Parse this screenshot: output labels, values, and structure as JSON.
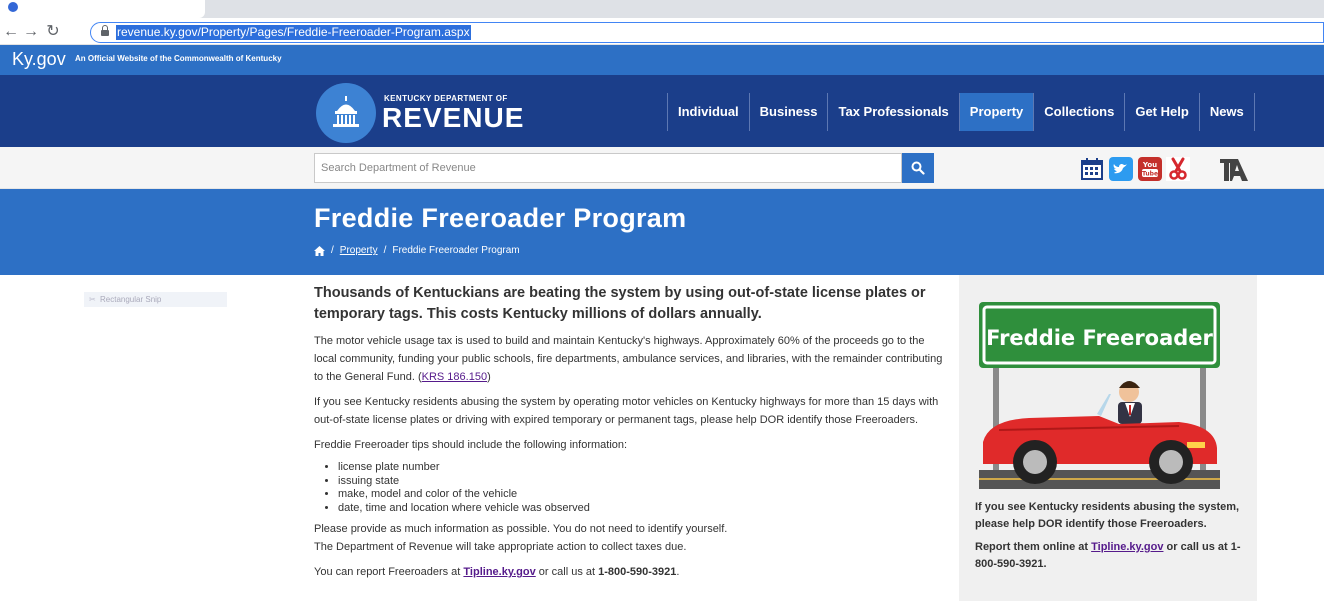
{
  "browser": {
    "url": "revenue.ky.gov/Property/Pages/Freddie-Freeroader-Program.aspx"
  },
  "kygov": {
    "logo_ky": "Ky",
    "logo_gov": ".gov",
    "tagline": "An Official Website of the Commonwealth of Kentucky"
  },
  "header": {
    "dept_small": "KENTUCKY DEPARTMENT OF",
    "dept_big": "REVENUE",
    "nav": [
      {
        "label": "Individual"
      },
      {
        "label": "Business"
      },
      {
        "label": "Tax Professionals"
      },
      {
        "label": "Property"
      },
      {
        "label": "Collections"
      },
      {
        "label": "Get Help"
      },
      {
        "label": "News"
      }
    ],
    "active_nav": "Property"
  },
  "search": {
    "placeholder": "Search Department of Revenue"
  },
  "social_icons": [
    "calendar-icon",
    "twitter-icon",
    "youtube-icon",
    "scissors-icon",
    "ta-icon"
  ],
  "banner": {
    "title": "Freddie Freeroader Program",
    "breadcrumb": [
      "Property",
      "Freddie Freeroader Program"
    ]
  },
  "snip": {
    "label": "Rectangular Snip"
  },
  "main": {
    "lead": "Thousands of Kentuckians are beating the system by using out-of-state license plates or temporary tags.  This costs Kentucky millions of dollars annually.",
    "p1_text": "The motor vehicle usage tax is used to build and maintain Kentucky's highways. Approximately 60% of the proceeds go to the local community, funding your public schools, fire departments, ambulance services, and libraries, with the remainder contributing to the General Fund.  (",
    "p1_link": "KRS 186.150",
    "p1_end": ")",
    "p2": "If you see Kentucky residents abusing the system by operating motor vehicles on Kentucky highways for more than 15 days with out-of-state license plates or driving with expired temporary or permanent tags, please help DOR identify those Freeroaders.",
    "p3": "Freddie Freeroader tips should include the following information:",
    "tips": [
      "license plate number",
      "issuing state",
      "make, model and color of the vehicle",
      "date, time and location where vehicle was observed"
    ],
    "p4a": "Please provide as much information as possible. You do not need to identify yourself.",
    "p4b": "The Department of Revenue will take appropriate action to collect taxes due.",
    "p5_pre": "You can report Freeroaders at ",
    "p5_link": "Tipline.ky.gov",
    "p5_mid": " or call us at ",
    "p5_phone": "1-800-590-3921",
    "p5_end": "."
  },
  "sidebar": {
    "sign_text": "Freddie Freeroader",
    "caption1": "If you see Kentucky residents abusing the system, please help DOR identify those Freeroaders.",
    "caption2_pre": "Report them online at ",
    "caption2_link": "Tipline.ky.gov",
    "caption2_mid": " or call us at ",
    "caption2_phone": "1-800-590-3921",
    "caption2_end": "."
  },
  "colors": {
    "ky_blue": "#2d70c5",
    "header_navy": "#1b3e8a",
    "sign_green": "#2f8f3c",
    "car_red": "#e02a2a"
  }
}
